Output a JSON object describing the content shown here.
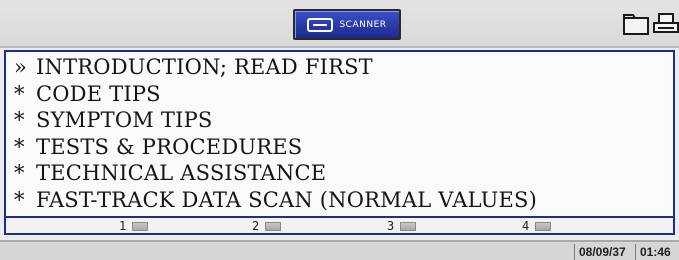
{
  "header": {
    "logo_label": "SCANNER",
    "icons": [
      "folder-icon",
      "printer-icon"
    ]
  },
  "menu": {
    "items": [
      {
        "marker": "»",
        "label": "INTRODUCTION; READ FIRST",
        "selected": true
      },
      {
        "marker": "*",
        "label": "CODE TIPS",
        "selected": false
      },
      {
        "marker": "*",
        "label": "SYMPTOM TIPS",
        "selected": false
      },
      {
        "marker": "*",
        "label": "TESTS & PROCEDURES",
        "selected": false
      },
      {
        "marker": "*",
        "label": "TECHNICAL ASSISTANCE",
        "selected": false
      },
      {
        "marker": "*",
        "label": "FAST-TRACK DATA SCAN (NORMAL VALUES)",
        "selected": false
      }
    ]
  },
  "softkeys": [
    {
      "label": "1"
    },
    {
      "label": "2"
    },
    {
      "label": "3"
    },
    {
      "label": "4"
    }
  ],
  "status": {
    "date": "08/09/37",
    "time": "01:46"
  },
  "colors": {
    "accent": "#1e2d8f",
    "logo_bg": "#2a3aa8"
  }
}
